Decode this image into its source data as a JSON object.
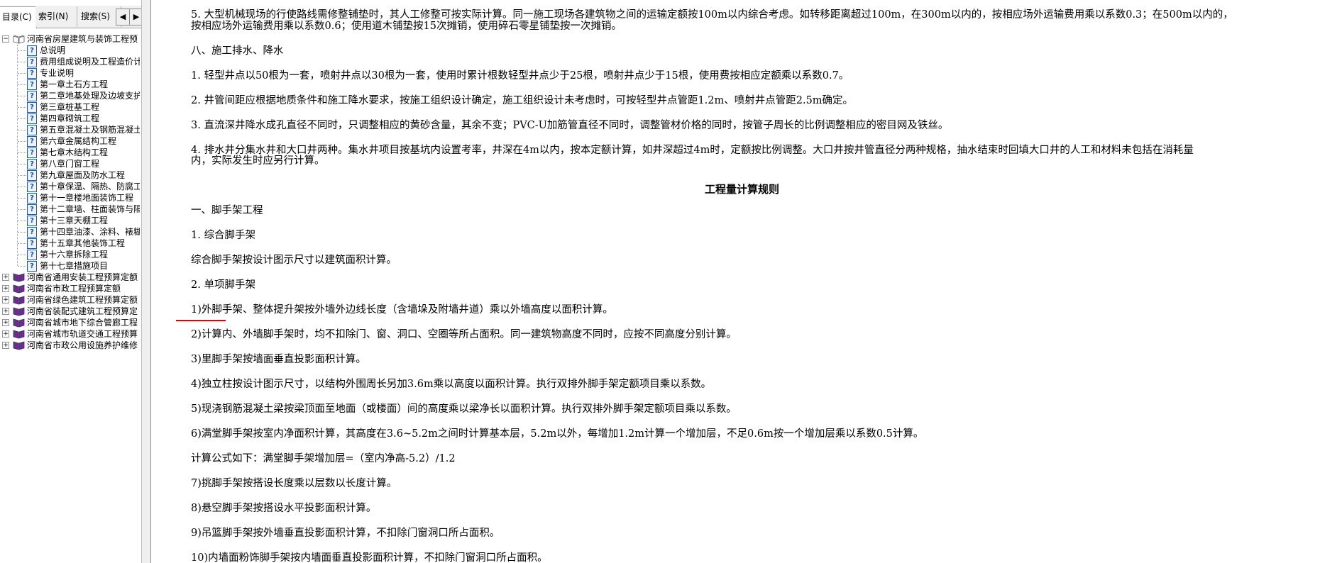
{
  "sidebar": {
    "tabs": [
      "目录(C)",
      "索引(N)",
      "搜索(S)"
    ],
    "nav_prev": "◀",
    "nav_next": "▶",
    "root": "河南省房屋建筑与装饰工程预",
    "children": [
      "总说明",
      "费用组成说明及工程造价计",
      "专业说明",
      "第一章土石方工程",
      "第二章地基处理及边坡支护",
      "第三章桩基工程",
      "第四章砌筑工程",
      "第五章混凝土及钢筋混凝土",
      "第六章金属结构工程",
      "第七章木结构工程",
      "第八章门窗工程",
      "第九章屋面及防水工程",
      "第十章保温、隔热、防腐工",
      "第十一章楼地面装饰工程",
      "第十二章墙、柱面装饰与隔",
      "第十三章天棚工程",
      "第十四章油漆、涂料、裱糊",
      "第十五章其他装饰工程",
      "第十六章拆除工程",
      "第十七章措施项目"
    ],
    "siblings": [
      "河南省通用安装工程预算定额",
      "河南省市政工程预算定额",
      "河南省绿色建筑工程预算定额",
      "河南省装配式建筑工程预算定",
      "河南省城市地下综合管廊工程",
      "河南省城市轨道交通工程预算",
      "河南省市政公用设施养护维修"
    ]
  },
  "content": {
    "p1a": "5. 大型机械现场的行使路线需修整铺垫时，其人工修整可按实际计算。同一施工现场各建筑物之间的运输定额按100m以内综合考虑。如转移距离超过100m，在300m以内的，按相应场外运输费用乘以系数0.3；在500m以内的，",
    "p1b": "按相应场外运输费用乘以系数0.6；使用道木铺垫按15次摊销，使用碎石零星铺垫按一次摊销。",
    "s8": "八、施工排水、降水",
    "p2": "1. 轻型井点以50根为一套，喷射井点以30根为一套，使用时累计根数轻型井点少于25根，喷射井点少于15根，使用费按相应定额乘以系数0.7。",
    "p3": "2. 井管间距应根据地质条件和施工降水要求，按施工组织设计确定，施工组织设计未考虑时，可按轻型井点管距1.2m、喷射井点管距2.5m确定。",
    "p4": "3. 直流深井降水成孔直径不同时，只调整相应的黄砂含量，其余不变；PVC-U加筋管直径不同时，调整管材价格的同时，按管子周长的比例调整相应的密目网及铁丝。",
    "p5a": "4. 排水井分集水井和大口井两种。集水井项目按基坑内设置考率，井深在4m以内，按本定额计算，如井深超过4m时，定额按比例调整。大口井按井管直径分两种规格，抽水结束时回填大口井的人工和材料未包括在消耗量",
    "p5b": "内，实际发生时应另行计算。",
    "title": "工程量计算规则",
    "s1": "一、脚手架工程",
    "s1_1": "1. 综合脚手架",
    "s1_1t": "综合脚手架按设计图示尺寸以建筑面积计算。",
    "s1_2": "2. 单项脚手架",
    "i1": "1)外脚手架、整体提升架按外墙外边线长度（含墙垛及附墙井道）乘以外墙高度以面积计算。",
    "i2": "2)计算内、外墙脚手架时，均不扣除门、窗、洞口、空圈等所占面积。同一建筑物高度不同时，应按不同高度分别计算。",
    "i3": "3)里脚手架按墙面垂直投影面积计算。",
    "i4": "4)独立柱按设计图示尺寸，以结构外围周长另加3.6m乘以高度以面积计算。执行双排外脚手架定额项目乘以系数。",
    "i5": "5)现浇钢筋混凝土梁按梁顶面至地面（或楼面）间的高度乘以梁净长以面积计算。执行双排外脚手架定额项目乘以系数。",
    "i6": "6)满堂脚手架按室内净面积计算，其高度在3.6~5.2m之间时计算基本层，5.2m以外，每增加1.2m计算一个增加层，不足0.6m按一个增加层乘以系数0.5计算。",
    "formula": "计算公式如下：满堂脚手架增加层=（室内净高-5.2）/1.2",
    "i7": "7)挑脚手架按搭设长度乘以层数以长度计算。",
    "i8": "8)悬空脚手架按搭设水平投影面积计算。",
    "i9": "9)吊篮脚手架按外墙垂直投影面积计算，不扣除门窗洞口所占面积。",
    "i10": "10)内墙面粉饰脚手架按内墙面垂直投影面积计算，不扣除门窗洞口所占面积。"
  }
}
